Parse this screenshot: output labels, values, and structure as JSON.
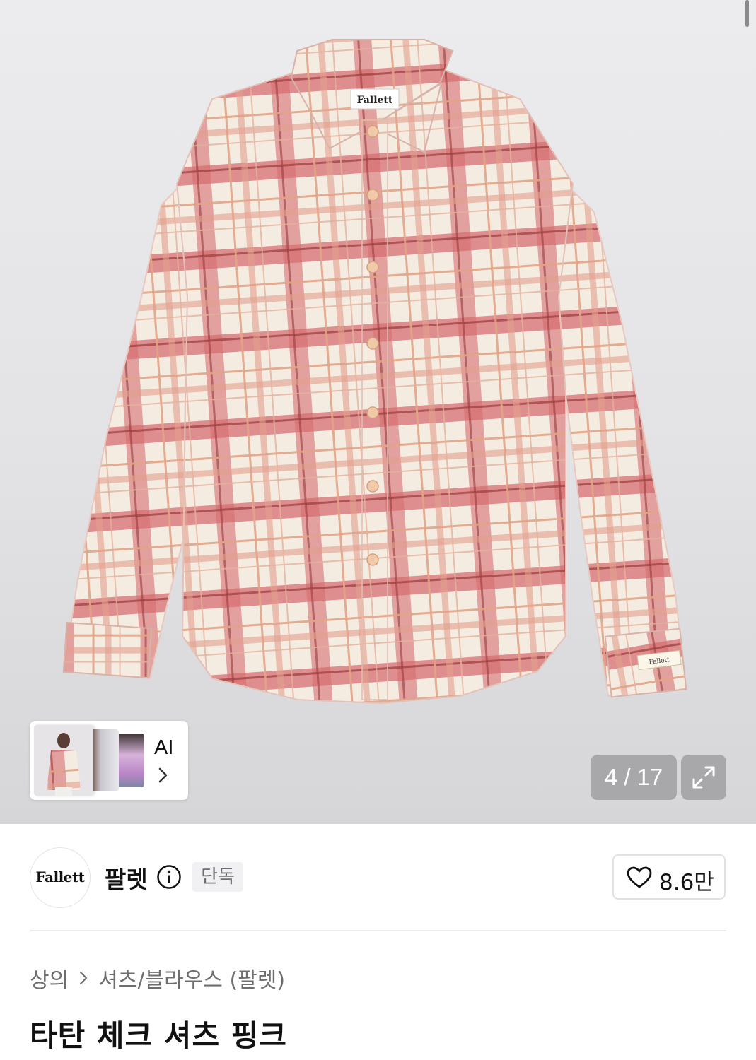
{
  "gallery": {
    "label_logo": "Fallett",
    "sleeve_label": "Fallett",
    "counter": "4 / 17",
    "ai_label": "AI"
  },
  "brand": {
    "logo_text": "Fallett",
    "name": "팔렛",
    "badge": "단독"
  },
  "like": {
    "count": "8.6만"
  },
  "breadcrumb": {
    "category": "상의",
    "subcategory": "셔츠/블라우스 (팔렛)"
  },
  "product": {
    "title": "타탄 체크 셔츠 핑크"
  },
  "colors": {
    "plaid_red": "#d0626a",
    "plaid_cream": "#f5ece2",
    "accent": "#111111"
  }
}
